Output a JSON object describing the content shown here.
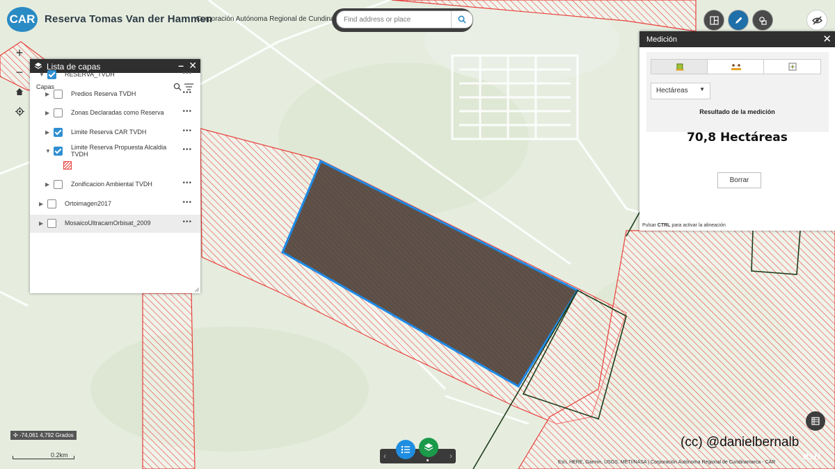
{
  "header": {
    "logo_text": "CAR",
    "title": "Reserva Tomas Van der Hammen",
    "subtitle": "Corporación Autónoma Regional de Cundinamarca",
    "search_placeholder": "Find address or place"
  },
  "header_tools": [
    "layout-icon",
    "pencil-icon",
    "analysis-icon"
  ],
  "visibility_icon": "eye-slash-icon",
  "map_controls": [
    "zoom-in",
    "zoom-out",
    "home",
    "locate"
  ],
  "layer_panel": {
    "title": "Lista de capas",
    "section_label": "Capas",
    "layers": [
      {
        "label": "RESERVA_TVDH",
        "checked": true,
        "expanded": true,
        "indent": 0
      },
      {
        "label": "Predios Reserva TVDH",
        "checked": false,
        "expanded": false,
        "indent": 1
      },
      {
        "label": "Zonas Declaradas como Reserva",
        "checked": false,
        "expanded": false,
        "indent": 1
      },
      {
        "label": "Limite Reserva CAR TVDH",
        "checked": true,
        "expanded": false,
        "indent": 1
      },
      {
        "label": "Limite Reserva Propuesta Alcaldia TVDH",
        "checked": true,
        "expanded": true,
        "indent": 1
      },
      {
        "label": "Zonificacion Ambiental TVDH",
        "checked": false,
        "expanded": false,
        "indent": 1
      },
      {
        "label": "Ortoimagen2017",
        "checked": false,
        "expanded": false,
        "indent": 0
      },
      {
        "label": "MosaicoUltracamOrbisat_2009",
        "checked": false,
        "expanded": false,
        "indent": 0
      }
    ]
  },
  "measure_panel": {
    "title": "Medición",
    "tools": [
      "area-tool-icon",
      "distance-tool-icon",
      "location-tool-icon"
    ],
    "unit": "Hectáreas",
    "result_label": "Resultado de la medición",
    "result_value": "70,8 Hectáreas",
    "clear_label": "Borrar",
    "hint_prefix": "Pulsar",
    "hint_key": "CTRL",
    "hint_suffix": "para activar la alineación"
  },
  "status": {
    "coordinates": "-74,061 4,792 Grados",
    "scale": "0.2km",
    "credit": "(cc) @danielbernalb",
    "attribution": "Esri, HERE, Garmin, USGS, METI/NASA | Corporación Autónoma Regional de Cundinamarca - CAR",
    "esri_logo": "esri"
  },
  "colors": {
    "hatch_red": "#e8413c",
    "measured_polygon": "#5a4f47",
    "measure_outline": "#1f8ae6",
    "boundary_green": "#1d3d1b",
    "header_dark": "#2f2f2f",
    "accent_blue": "#1f8ee0",
    "accent_green": "#1b9a4a"
  }
}
